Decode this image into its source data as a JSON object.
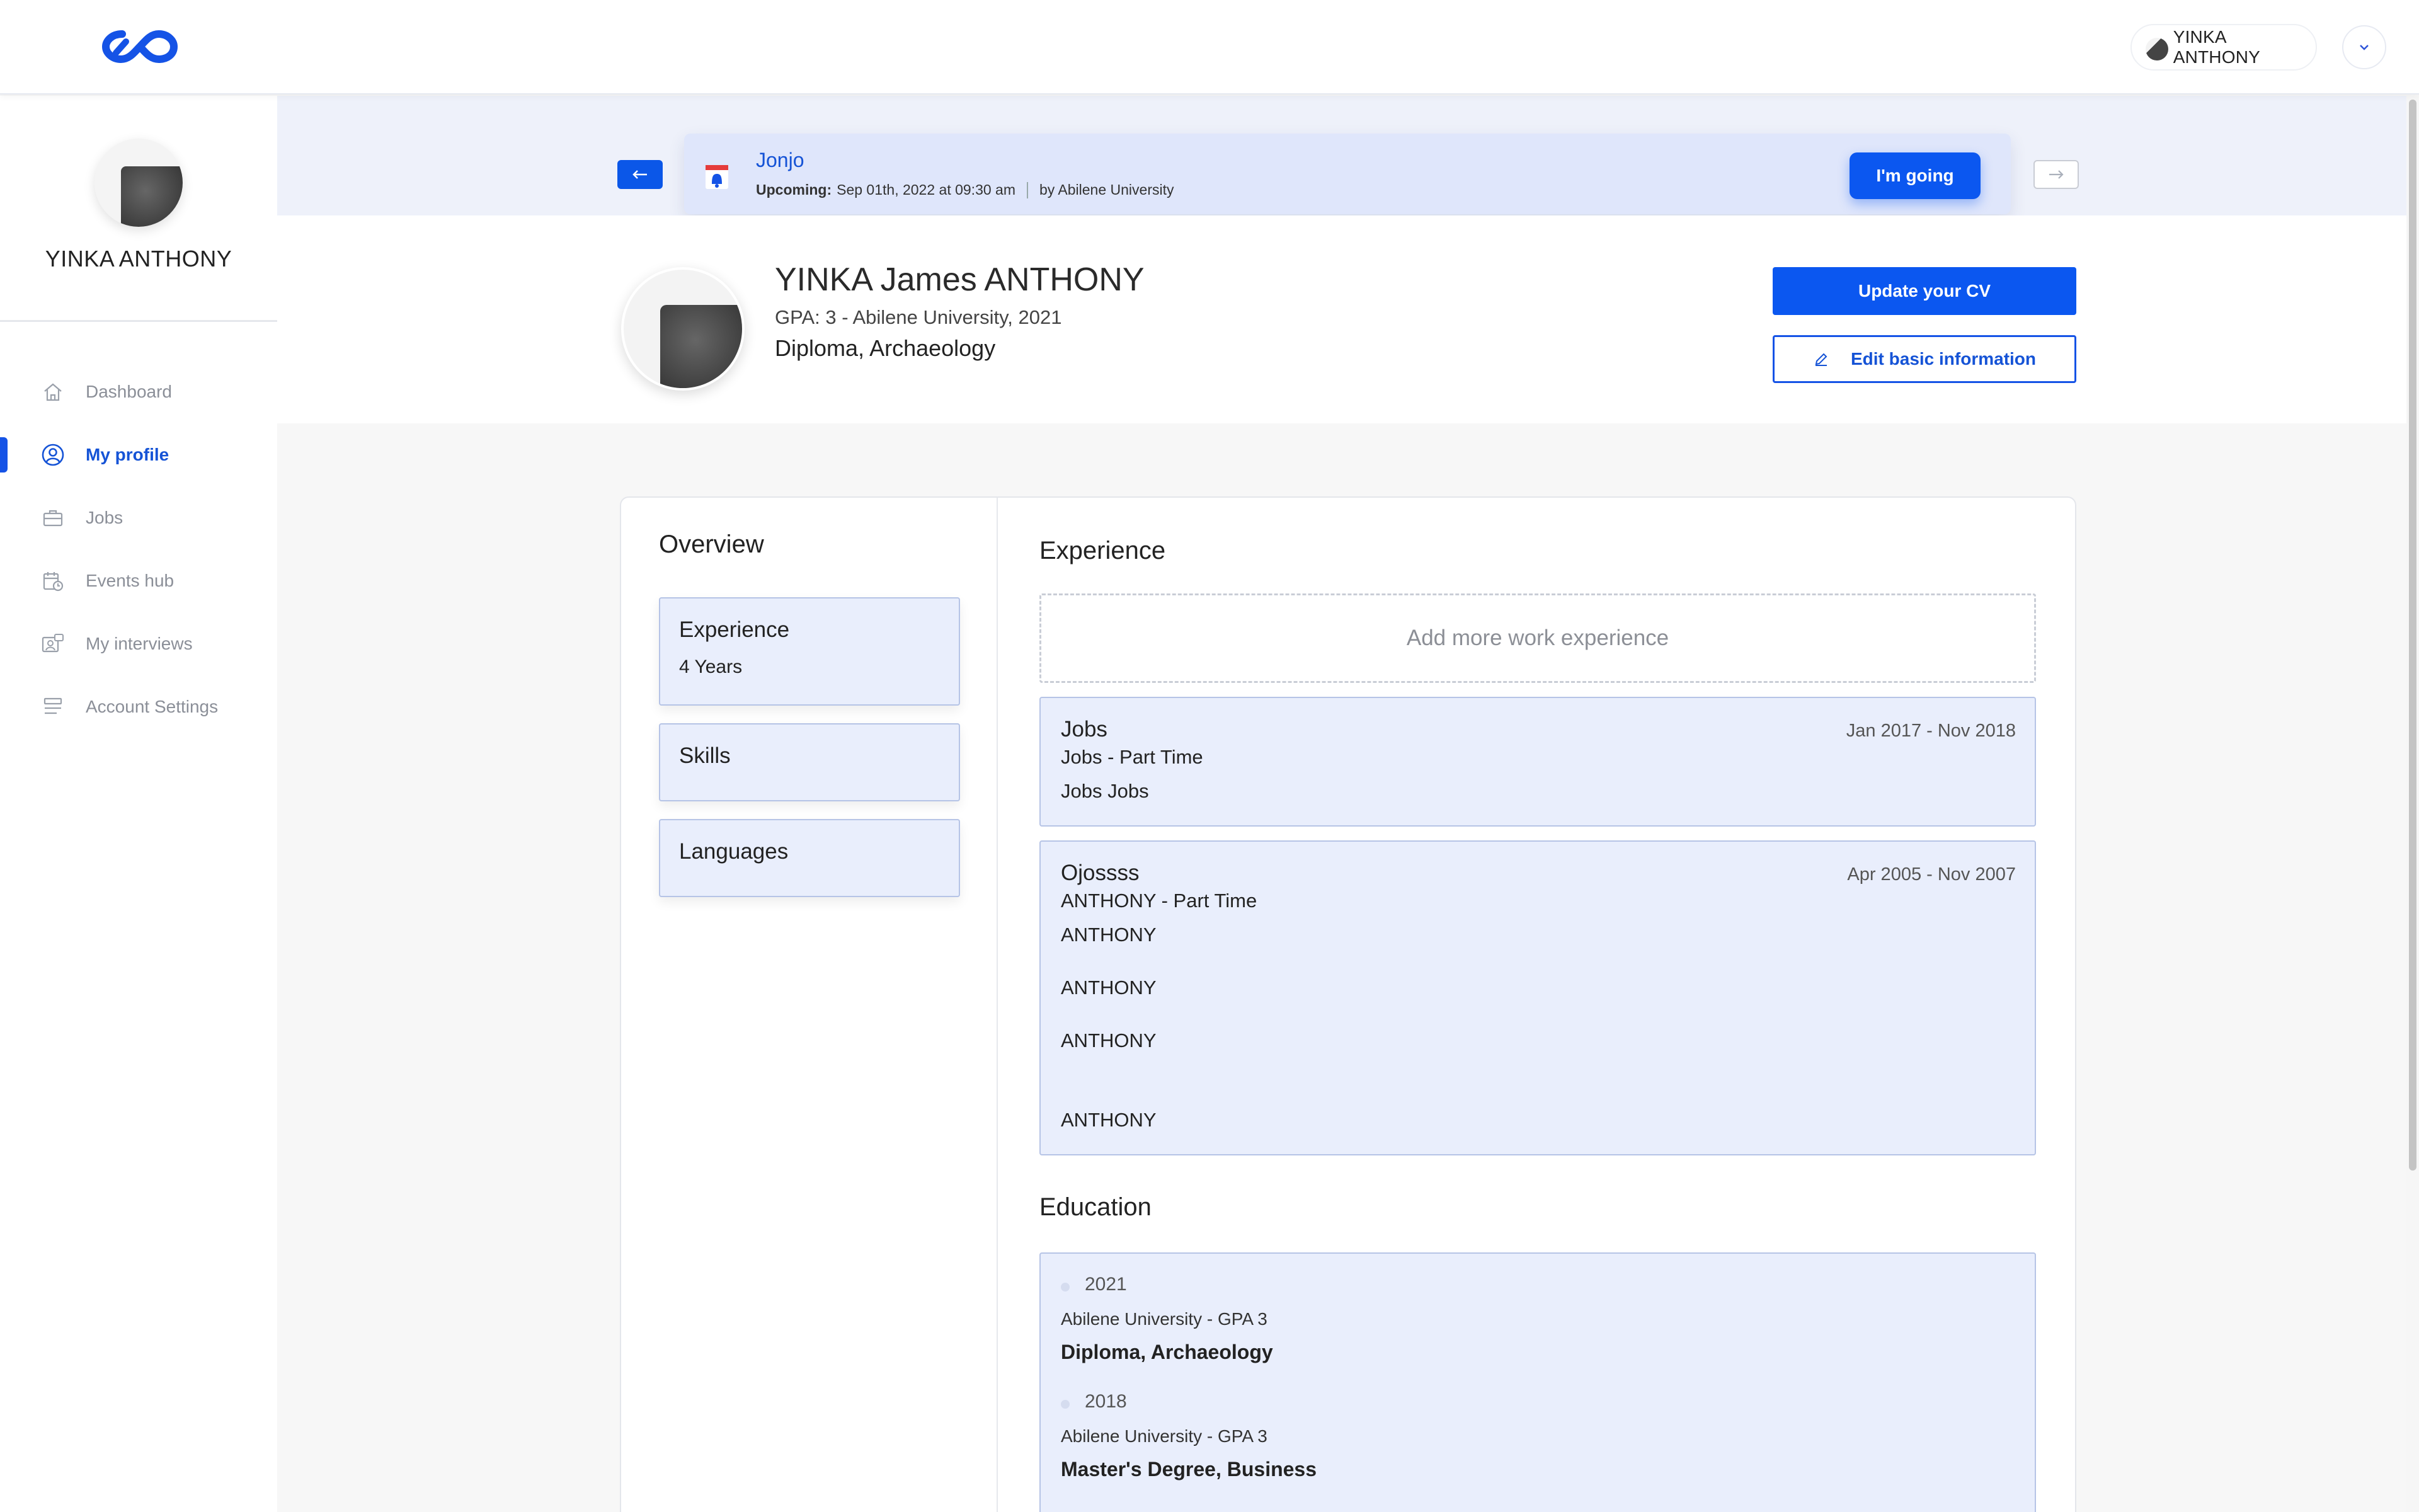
{
  "header": {
    "logo_icon": "infinity-logo",
    "user_name": "YINKA ANTHONY",
    "menu_icon": "chevron-down-icon"
  },
  "sidebar": {
    "user_name": "YINKA ANTHONY",
    "items": [
      {
        "label": "Dashboard",
        "icon": "home-icon",
        "active": false
      },
      {
        "label": "My profile",
        "icon": "user-circle-icon",
        "active": true
      },
      {
        "label": "Jobs",
        "icon": "briefcase-icon",
        "active": false
      },
      {
        "label": "Events hub",
        "icon": "calendar-clock-icon",
        "active": false
      },
      {
        "label": "My interviews",
        "icon": "interview-icon",
        "active": false
      },
      {
        "label": "Account Settings",
        "icon": "settings-list-icon",
        "active": false
      }
    ]
  },
  "event_banner": {
    "title": "Jonjo",
    "upcoming_label": "Upcoming:",
    "date": "Sep 01th, 2022 at 09:30 am",
    "organizer": "by Abilene University",
    "going_label": "I'm going",
    "prev_icon": "arrow-left-icon",
    "next_icon": "arrow-right-icon"
  },
  "profile": {
    "full_name": "YINKA James ANTHONY",
    "gpa_line": "GPA: 3 - Abilene University, 2021",
    "degree": "Diploma, Archaeology",
    "update_cv_label": "Update your CV",
    "edit_info_label": "Edit basic information"
  },
  "overview": {
    "title": "Overview",
    "boxes": [
      {
        "title": "Experience",
        "subtitle": "4 Years"
      },
      {
        "title": "Skills",
        "subtitle": ""
      },
      {
        "title": "Languages",
        "subtitle": ""
      }
    ]
  },
  "experience": {
    "title": "Experience",
    "add_label": "Add more work experience",
    "items": [
      {
        "company": "Jobs",
        "dates": "Jan 2017 - Nov 2018",
        "lines": [
          "Jobs - Part Time",
          "Jobs Jobs"
        ]
      },
      {
        "company": "Ojossss",
        "dates": "Apr 2005 - Nov 2007",
        "lines": [
          "ANTHONY - Part Time",
          "ANTHONY",
          "ANTHONY",
          "ANTHONY",
          "ANTHONY"
        ]
      }
    ]
  },
  "education": {
    "title": "Education",
    "items": [
      {
        "year": "2021",
        "school": "Abilene University - GPA 3",
        "degree": "Diploma, Archaeology"
      },
      {
        "year": "2018",
        "school": "Abilene University - GPA 3",
        "degree": "Master's Degree, Business"
      }
    ]
  },
  "colors": {
    "primary": "#0b57f0",
    "card_bg": "#e9eefc",
    "card_border": "#b6c4e6"
  }
}
